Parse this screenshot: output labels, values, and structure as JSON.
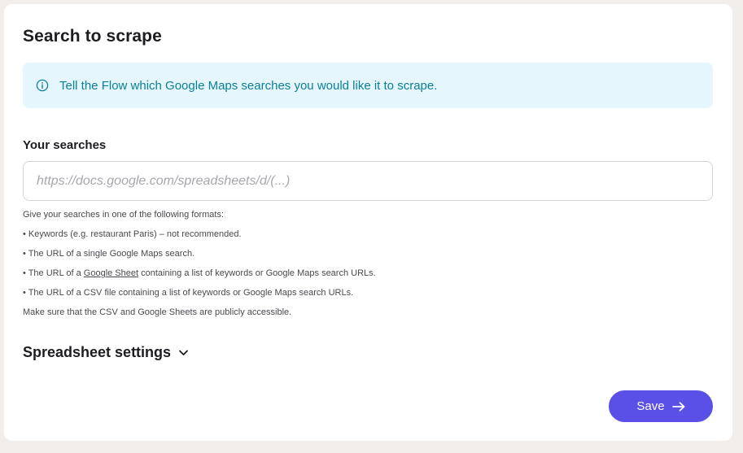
{
  "form": {
    "title": "Search to scrape",
    "info_banner": {
      "icon": "info-circle-icon",
      "text": "Tell the Flow which Google Maps searches you would like it to scrape."
    },
    "searches": {
      "label": "Your searches",
      "value": "",
      "placeholder": "https://docs.google.com/spreadsheets/d/(...)"
    },
    "help": {
      "intro": "Give your searches in one of the following formats:",
      "item_keywords": "• Keywords (e.g. restaurant Paris) – not recommended.",
      "item_single_url": "• The URL of a single Google Maps search.",
      "item_sheet_prefix": "• The URL of a ",
      "item_sheet_link": "Google Sheet",
      "item_sheet_suffix": " containing a list of keywords or Google Maps search URLs.",
      "item_csv": "• The URL of a CSV file containing a list of keywords or Google Maps search URLs.",
      "note": "Make sure that the CSV and Google Sheets are publicly accessible."
    },
    "spreadsheet_settings": {
      "label": "Spreadsheet settings",
      "icon": "chevron-down-icon",
      "expanded": false
    },
    "save_button": {
      "label": "Save",
      "icon": "arrow-right-icon"
    }
  },
  "colors": {
    "page_background": "#f2eeec",
    "card_background": "#ffffff",
    "info_background": "#e5f7fc",
    "info_text": "#0b7f9a",
    "primary_button": "#5a4fe6",
    "heading_text": "#1d1c21",
    "placeholder_text": "#a8a6ad"
  }
}
